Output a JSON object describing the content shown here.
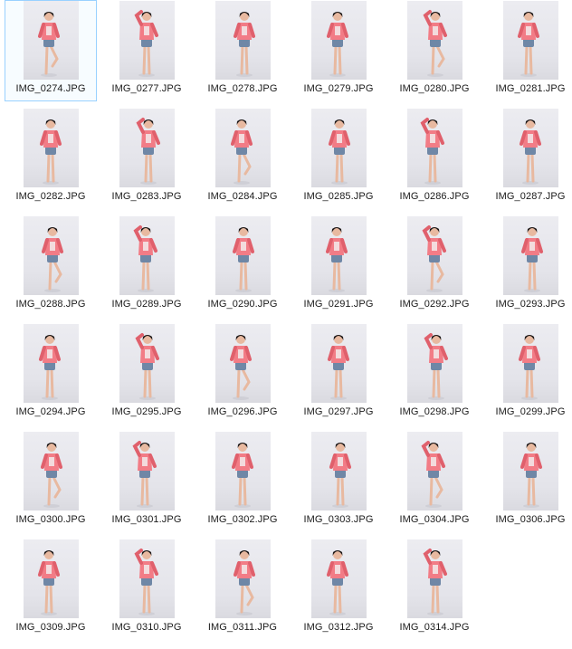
{
  "files": [
    {
      "name": "IMG_0274.JPG",
      "selected": true
    },
    {
      "name": "IMG_0277.JPG"
    },
    {
      "name": "IMG_0278.JPG"
    },
    {
      "name": "IMG_0279.JPG"
    },
    {
      "name": "IMG_0280.JPG"
    },
    {
      "name": "IMG_0281.JPG"
    },
    {
      "name": "IMG_0282.JPG"
    },
    {
      "name": "IMG_0283.JPG"
    },
    {
      "name": "IMG_0284.JPG"
    },
    {
      "name": "IMG_0285.JPG"
    },
    {
      "name": "IMG_0286.JPG"
    },
    {
      "name": "IMG_0287.JPG"
    },
    {
      "name": "IMG_0288.JPG"
    },
    {
      "name": "IMG_0289.JPG"
    },
    {
      "name": "IMG_0290.JPG"
    },
    {
      "name": "IMG_0291.JPG"
    },
    {
      "name": "IMG_0292.JPG"
    },
    {
      "name": "IMG_0293.JPG"
    },
    {
      "name": "IMG_0294.JPG"
    },
    {
      "name": "IMG_0295.JPG"
    },
    {
      "name": "IMG_0296.JPG"
    },
    {
      "name": "IMG_0297.JPG"
    },
    {
      "name": "IMG_0298.JPG"
    },
    {
      "name": "IMG_0299.JPG"
    },
    {
      "name": "IMG_0300.JPG"
    },
    {
      "name": "IMG_0301.JPG"
    },
    {
      "name": "IMG_0302.JPG"
    },
    {
      "name": "IMG_0303.JPG"
    },
    {
      "name": "IMG_0304.JPG"
    },
    {
      "name": "IMG_0306.JPG"
    },
    {
      "name": "IMG_0309.JPG"
    },
    {
      "name": "IMG_0310.JPG"
    },
    {
      "name": "IMG_0311.JPG"
    },
    {
      "name": "IMG_0312.JPG"
    },
    {
      "name": "IMG_0314.JPG"
    }
  ],
  "colors": {
    "sweater": "#f27c86",
    "sweater_shade": "#e0606c",
    "shorts": "#6f87a6",
    "skin": "#e8b9a0",
    "hair": "#1e1a1a",
    "backdrop": "#e8e8ee",
    "selection_border": "#99d1ff"
  }
}
